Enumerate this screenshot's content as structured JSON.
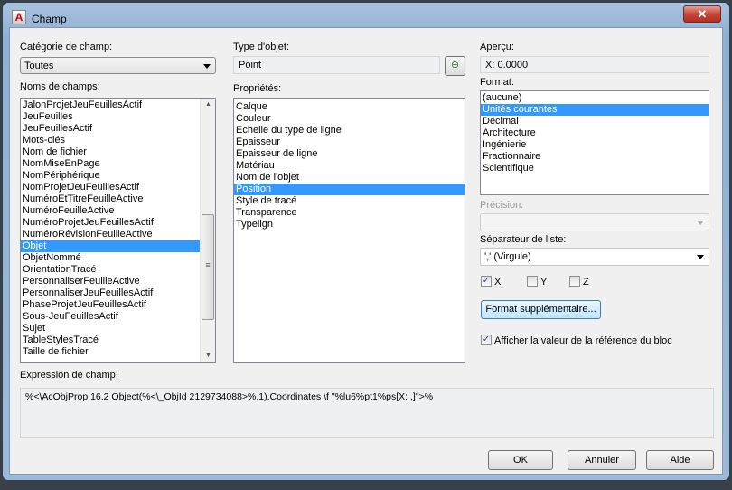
{
  "window": {
    "title": "Champ",
    "close_icon": "close-icon",
    "app_icon": "autocad-icon"
  },
  "category": {
    "label": "Catégorie de champ:",
    "value": "Toutes"
  },
  "field_names": {
    "label": "Noms de champs:",
    "items": [
      "JalonProjetJeuFeuillesActif",
      "JeuFeuilles",
      "JeuFeuillesActif",
      "Mots-clés",
      "Nom de fichier",
      "NomMiseEnPage",
      "NomPériphérique",
      "NomProjetJeuFeuillesActif",
      "NuméroEtTitreFeuilleActive",
      "NuméroFeuilleActive",
      "NuméroProjetJeuFeuillesActif",
      "NuméroRévisionFeuilleActive",
      "Objet",
      "ObjetNommé",
      "OrientationTracé",
      "PersonnaliserFeuilleActive",
      "PersonnaliserJeuFeuillesActif",
      "PhaseProjetJeuFeuillesActif",
      "Sous-JeuFeuillesActif",
      "Sujet",
      "TableStylesTracé",
      "Taille de fichier"
    ],
    "selected": "Objet"
  },
  "object_type": {
    "label": "Type d'objet:",
    "value": "Point",
    "select_button_icon": "select-object-icon"
  },
  "properties": {
    "label": "Propriétés:",
    "items": [
      "Calque",
      "Couleur",
      "Echelle du type de ligne",
      "Epaisseur",
      "Epaisseur de ligne",
      "Matériau",
      "Nom de l'objet",
      "Position",
      "Style de tracé",
      "Transparence",
      "Typelign"
    ],
    "selected": "Position"
  },
  "preview": {
    "label": "Aperçu:",
    "value": "X: 0.0000"
  },
  "format": {
    "label": "Format:",
    "items": [
      "(aucune)",
      "Unités courantes",
      "Décimal",
      "Architecture",
      "Ingénierie",
      "Fractionnaire",
      "Scientifique"
    ],
    "selected": "Unités courantes"
  },
  "precision": {
    "label": "Précision:",
    "value": ""
  },
  "separator": {
    "label": "Séparateur de liste:",
    "value": "',' (Virgule)"
  },
  "axes": [
    {
      "label": "X",
      "checked": true
    },
    {
      "label": "Y",
      "checked": false
    },
    {
      "label": "Z",
      "checked": false
    }
  ],
  "additional_format_button": "Format supplémentaire...",
  "block_ref": {
    "label": "Afficher la valeur de la référence du bloc",
    "checked": true
  },
  "expression": {
    "label": "Expression de champ:",
    "value": "%<\\AcObjProp.16.2 Object(%<\\_ObjId 2129734088>%,1).Coordinates \\f \"%lu6%pt1%ps[X: ,]\">%"
  },
  "buttons": {
    "ok": "OK",
    "cancel": "Annuler",
    "help": "Aide"
  }
}
